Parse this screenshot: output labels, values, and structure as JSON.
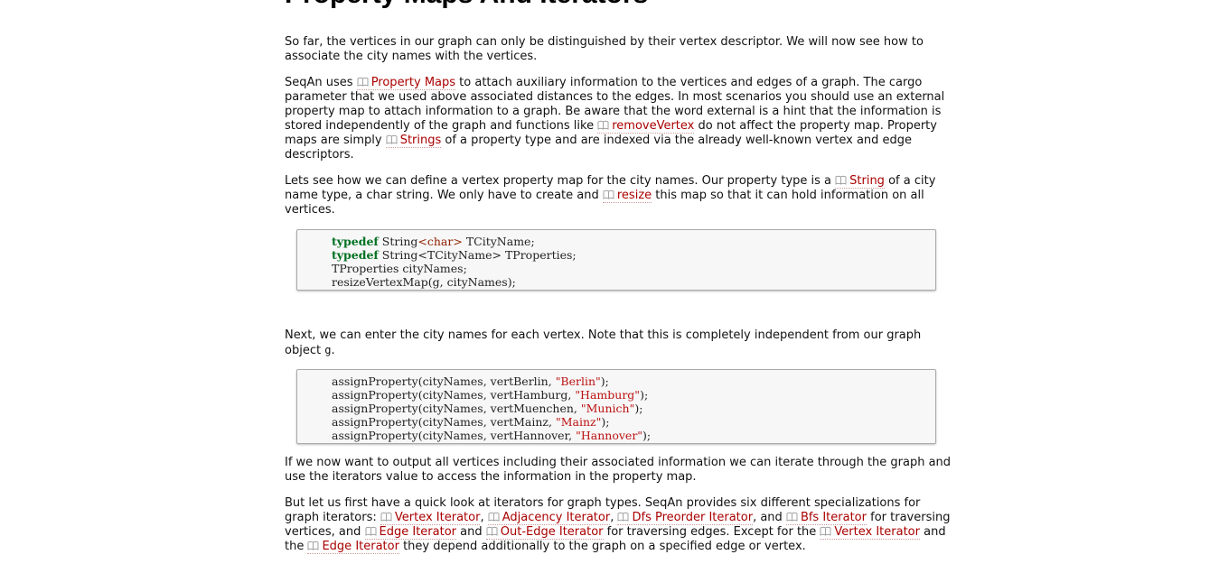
{
  "heading": "Property Maps And Iterators",
  "p1": "So far, the vertices in our graph can only be distinguished by their vertex descriptor. We will now see how to associate the city names with the vertices.",
  "p2": {
    "t1": "SeqAn uses ",
    "link_property_maps": "Property Maps",
    "t2": " to attach auxiliary information to the vertices and edges of a graph. The cargo parameter that we used above associated distances to the edges. In most scenarios you should use an external property map to attach information to a graph. Be aware that the word external is a hint that the information is stored independently of the graph and functions like ",
    "link_remove_vertex": "removeVertex",
    "t3": " do not affect the property map. Property maps are simply ",
    "link_strings": "Strings",
    "t4": " of a property type and are indexed via the already well-known vertex and edge descriptors."
  },
  "p3": {
    "t1": "Lets see how we can define a vertex property map for the city names. Our property type is a ",
    "link_string": "String",
    "t2": " of a city name type, a char string. We only have to create and ",
    "link_resize": "resize",
    "t3": " this map so that it can hold information on all vertices."
  },
  "code1": [
    {
      "kw": "typedef",
      "a": " String",
      "ty": "<char>",
      "b": " TCityName;"
    },
    {
      "kw": "typedef",
      "a": " String<TCityName> TProperties;"
    },
    {
      "a": "TProperties cityNames;"
    },
    {
      "a": "resizeVertexMap(g, cityNames);"
    }
  ],
  "p4": {
    "t1": "Next, we can enter the city names for each vertex. Note that this is completely independent from our graph object ",
    "code_g": "g",
    "t2": "."
  },
  "code2": [
    {
      "a": "assignProperty(cityNames, vertBerlin, ",
      "s": "\"Berlin\"",
      "b": ");"
    },
    {
      "a": "assignProperty(cityNames, vertHamburg, ",
      "s": "\"Hamburg\"",
      "b": ");"
    },
    {
      "a": "assignProperty(cityNames, vertMuenchen, ",
      "s": "\"Munich\"",
      "b": ");"
    },
    {
      "a": "assignProperty(cityNames, vertMainz, ",
      "s": "\"Mainz\"",
      "b": ");"
    },
    {
      "a": "assignProperty(cityNames, vertHannover, ",
      "s": "\"Hannover\"",
      "b": ");"
    }
  ],
  "p5": "If we now want to output all vertices including their associated information we can iterate through the graph and use the iterators value to access the information in the property map.",
  "p6": {
    "t1": "But let us first have a quick look at iterators for graph types. SeqAn provides six different specializations for graph iterators: ",
    "link_vertex_iterator": "Vertex Iterator",
    "sep1": ", ",
    "link_adjacency_iterator": "Adjacency Iterator",
    "sep2": ", ",
    "link_dfs_iterator": "Dfs Preorder Iterator",
    "sep3": ", and ",
    "link_bfs_iterator": "Bfs Iterator",
    "t2": " for traversing vertices, and ",
    "link_edge_iterator": "Edge Iterator",
    "t3": " and ",
    "link_out_edge_iterator": "Out-Edge Iterator",
    "t4": " for traversing edges. Except for the ",
    "link_vertex_iterator2": "Vertex Iterator",
    "t5": " and the ",
    "link_edge_iterator2": "Edge Iterator",
    "t6": " they depend additionally to the graph on a specified edge or vertex."
  },
  "icons": {
    "doc_link": "book-icon",
    "link_color": "#aa0000"
  }
}
